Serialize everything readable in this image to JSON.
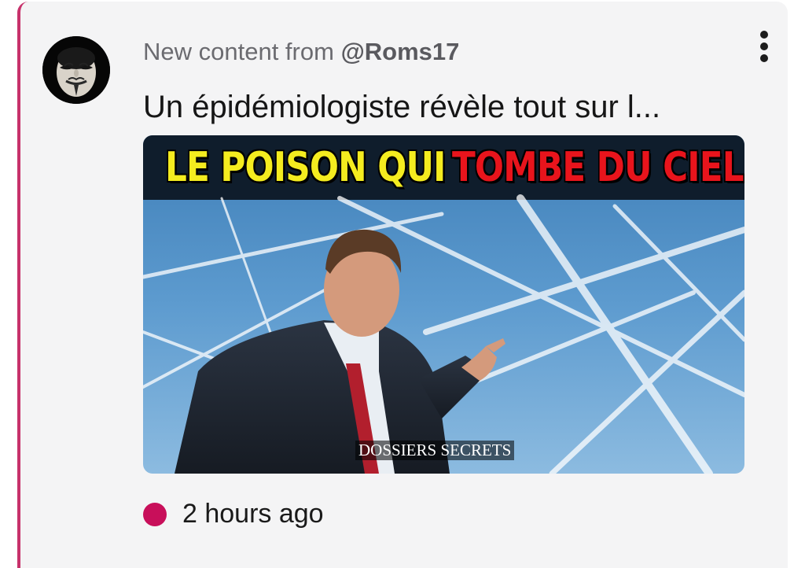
{
  "post": {
    "header_prefix": "New content from",
    "author_handle": "@Roms17",
    "title": "Un épidémiologiste révèle tout sur l...",
    "timestamp": "2 hours ago"
  },
  "thumbnail": {
    "headline_part1": "LE POISON QUI",
    "headline_part2": "TOMBE DU CIEL.",
    "watermark": "DOSSIERS SECRETS"
  },
  "colors": {
    "accent": "#c7326b",
    "status_dot": "#c80f5a",
    "headline_yellow": "#f4ec1f",
    "headline_red": "#e8141c"
  },
  "icons": {
    "menu": "more-vertical-icon",
    "avatar": "anonymous-mask-avatar"
  }
}
